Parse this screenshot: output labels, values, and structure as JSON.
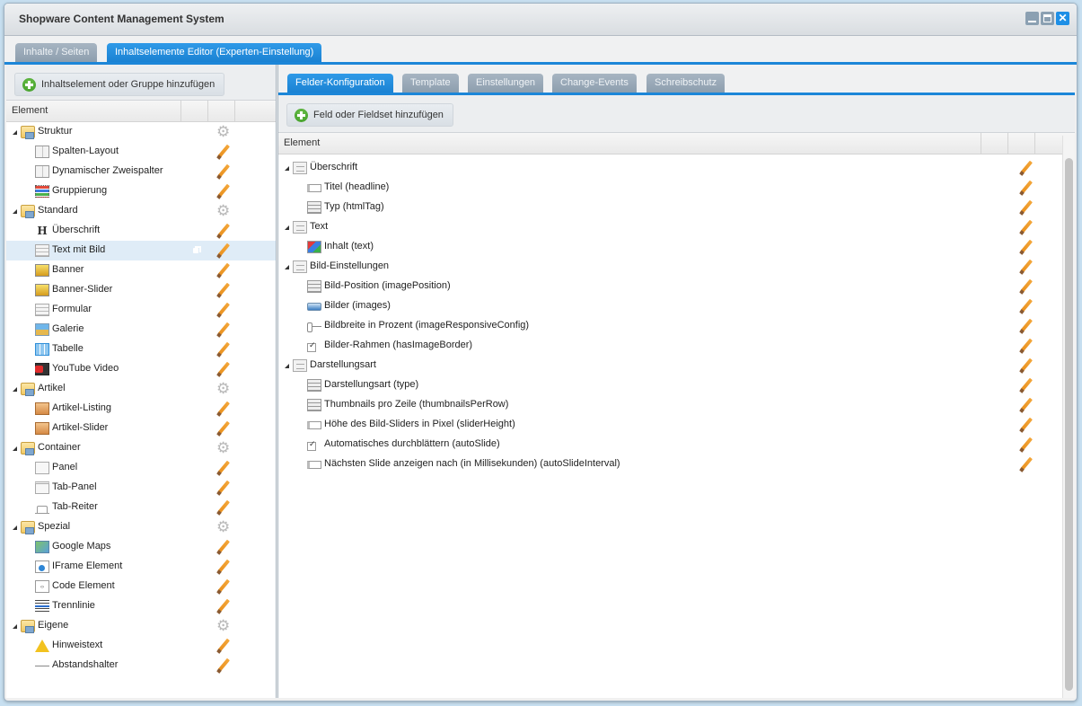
{
  "window": {
    "title": "Shopware Content Management System",
    "buttons": [
      "minimize",
      "maximize",
      "close"
    ]
  },
  "main_tabs": [
    {
      "label": "Inhalte / Seiten",
      "active": false
    },
    {
      "label": "Inhaltselemente Editor (Experten-Einstellung)",
      "active": true
    }
  ],
  "left": {
    "add_button": "Inhaltselement oder Gruppe hinzufügen",
    "column_header": "Element",
    "groups": [
      {
        "label": "Struktur",
        "items": [
          {
            "label": "Spalten-Layout",
            "icon": "columns-icon"
          },
          {
            "label": "Dynamischer Zweispalter",
            "icon": "columns-icon"
          },
          {
            "label": "Gruppierung",
            "icon": "grouping-icon"
          }
        ]
      },
      {
        "label": "Standard",
        "items": [
          {
            "label": "Überschrift",
            "icon": "heading-icon"
          },
          {
            "label": "Text mit Bild",
            "icon": "text-image-icon",
            "selected": true
          },
          {
            "label": "Banner",
            "icon": "banner-icon"
          },
          {
            "label": "Banner-Slider",
            "icon": "banner-slider-icon"
          },
          {
            "label": "Formular",
            "icon": "form-icon"
          },
          {
            "label": "Galerie",
            "icon": "gallery-icon"
          },
          {
            "label": "Tabelle",
            "icon": "table-icon"
          },
          {
            "label": "YouTube Video",
            "icon": "youtube-icon"
          }
        ]
      },
      {
        "label": "Artikel",
        "items": [
          {
            "label": "Artikel-Listing",
            "icon": "article-box-icon"
          },
          {
            "label": "Artikel-Slider",
            "icon": "article-box-icon"
          }
        ]
      },
      {
        "label": "Container",
        "items": [
          {
            "label": "Panel",
            "icon": "panel-icon"
          },
          {
            "label": "Tab-Panel",
            "icon": "tab-panel-icon"
          },
          {
            "label": "Tab-Reiter",
            "icon": "tab-icon"
          }
        ]
      },
      {
        "label": "Spezial",
        "items": [
          {
            "label": "Google Maps",
            "icon": "map-icon"
          },
          {
            "label": "IFrame Element",
            "icon": "iframe-icon"
          },
          {
            "label": "Code Element",
            "icon": "code-icon"
          },
          {
            "label": "Trennlinie",
            "icon": "divider-line-icon"
          }
        ]
      },
      {
        "label": "Eigene",
        "items": [
          {
            "label": "Hinweistext",
            "icon": "warning-icon"
          },
          {
            "label": "Abstandshalter",
            "icon": "spacer-icon"
          }
        ]
      }
    ]
  },
  "right": {
    "tabs": [
      {
        "label": "Felder-Konfiguration",
        "active": true
      },
      {
        "label": "Template",
        "active": false
      },
      {
        "label": "Einstellungen",
        "active": false
      },
      {
        "label": "Change-Events",
        "active": false
      },
      {
        "label": "Schreibschutz",
        "active": false
      }
    ],
    "add_button": "Feld oder Fieldset hinzufügen",
    "column_header": "Element",
    "fieldsets": [
      {
        "label": "Überschrift",
        "fields": [
          {
            "label": "Titel (headline)",
            "icon": "textfield-icon"
          },
          {
            "label": "Typ (htmlTag)",
            "icon": "combobox-icon"
          }
        ]
      },
      {
        "label": "Text",
        "fields": [
          {
            "label": "Inhalt (text)",
            "icon": "html-editor-icon"
          }
        ]
      },
      {
        "label": "Bild-Einstellungen",
        "fields": [
          {
            "label": "Bild-Position (imagePosition)",
            "icon": "combobox-icon"
          },
          {
            "label": "Bilder (images)",
            "icon": "media-icon"
          },
          {
            "label": "Bildbreite in Prozent (imageResponsiveConfig)",
            "icon": "slider-icon"
          },
          {
            "label": "Bilder-Rahmen (hasImageBorder)",
            "icon": "checkbox-icon"
          }
        ]
      },
      {
        "label": "Darstellungsart",
        "fields": [
          {
            "label": "Darstellungsart (type)",
            "icon": "combobox-icon"
          },
          {
            "label": "Thumbnails pro Zeile (thumbnailsPerRow)",
            "icon": "combobox-icon"
          },
          {
            "label": "Höhe des Bild-Sliders in Pixel (sliderHeight)",
            "icon": "textfield-icon"
          },
          {
            "label": "Automatisches durchblättern (autoSlide)",
            "icon": "checkbox-icon"
          },
          {
            "label": "Nächsten Slide anzeigen nach (in Millisekunden) (autoSlideInterval)",
            "icon": "textfield-icon"
          }
        ]
      }
    ]
  },
  "colors": {
    "accent": "#1c86d8",
    "add": "#3c9a25",
    "delete": "#d8383a",
    "duplicate": "#3a8fae",
    "edit": "#e88f1c",
    "selected_row": "#dfecf7"
  }
}
